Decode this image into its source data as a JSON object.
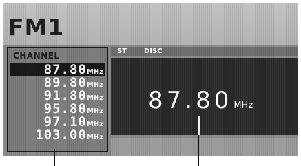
{
  "header": {
    "band_label": "FM1"
  },
  "channel_list": {
    "title": "CHANNEL",
    "items": [
      {
        "freq": "87.80",
        "unit": "MHz",
        "selected": true
      },
      {
        "freq": "89.80",
        "unit": "MHz",
        "selected": false
      },
      {
        "freq": "91.80",
        "unit": "MHz",
        "selected": false
      },
      {
        "freq": "95.80",
        "unit": "MHz",
        "selected": false
      },
      {
        "freq": "97.10",
        "unit": "MHz",
        "selected": false
      },
      {
        "freq": "103.00",
        "unit": "MHz",
        "selected": false
      }
    ]
  },
  "status": {
    "stereo": "ST",
    "disc": "DISC"
  },
  "display": {
    "frequency": "87.80",
    "unit": "MHz"
  },
  "colors": {
    "selected_row": "#1a1a1a",
    "display_bg": "#2a2a2a",
    "band_bg": "#c2c2c2"
  }
}
